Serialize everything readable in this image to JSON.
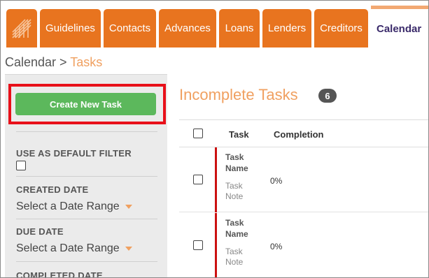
{
  "nav": {
    "logo_icon": "arrow-grid-logo-icon",
    "tabs": [
      {
        "label": "Guidelines"
      },
      {
        "label": "Contacts"
      },
      {
        "label": "Advances"
      },
      {
        "label": "Loans"
      },
      {
        "label": "Lenders"
      },
      {
        "label": "Creditors"
      },
      {
        "label": "Calendar",
        "active": true
      }
    ]
  },
  "breadcrumb": {
    "parent": "Calendar",
    "separator": " > ",
    "current": "Tasks"
  },
  "sidebar": {
    "create_button": "Create New Task",
    "default_filter_label": "USE AS DEFAULT FILTER",
    "created_date_label": "CREATED DATE",
    "created_date_value": "Select a Date Range",
    "due_date_label": "DUE DATE",
    "due_date_value": "Select a Date Range",
    "completed_date_label": "COMPLETED DATE"
  },
  "main": {
    "title": "Incomplete Tasks",
    "count": "6",
    "columns": [
      "Task",
      "Completion"
    ],
    "rows": [
      {
        "name_line1": "Task",
        "name_line2": "Name",
        "note_line1": "Task",
        "note_line2": "Note",
        "completion": "0%"
      },
      {
        "name_line1": "Task",
        "name_line2": "Name",
        "note_line1": "Task",
        "note_line2": "Note",
        "completion": "0%"
      }
    ]
  },
  "colors": {
    "accent": "#e8741f",
    "highlight": "#e8101a",
    "success": "#5cb85c",
    "title": "#f0a060"
  }
}
